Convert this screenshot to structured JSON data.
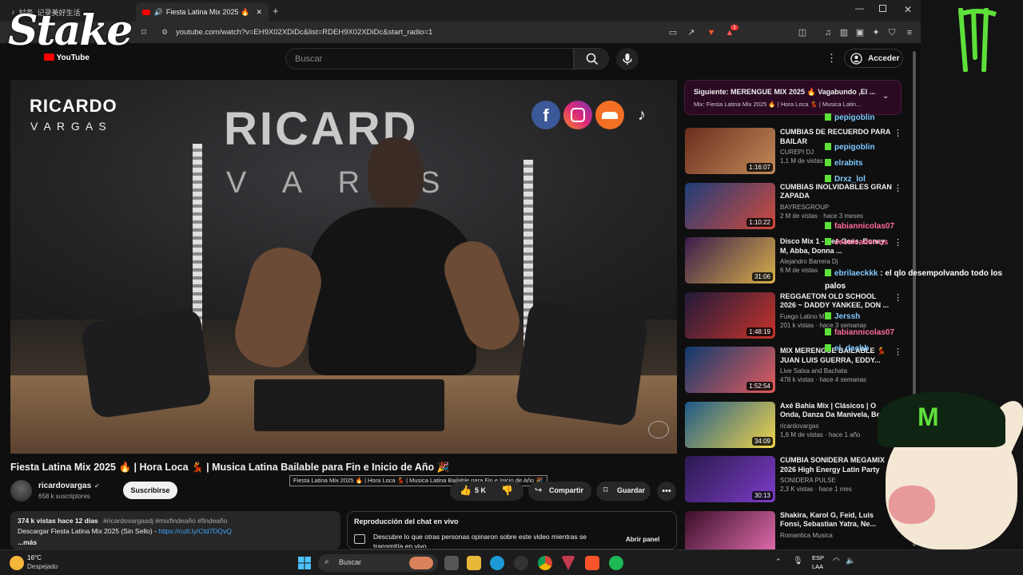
{
  "browser": {
    "tab_inactive": "村务, 记录美好生活",
    "tab_active": "Fiesta Latina Mix 2025 🔥 | Ho",
    "url": "youtube.com/watch?v=EH9X02XDiDc&list=RDEH9X02XDiDc&start_radio=1",
    "ext_badge": "1"
  },
  "overlay": {
    "stake_logo": "Stake",
    "youtube_logo": "YouTube"
  },
  "youtube": {
    "search_placeholder": "Buscar",
    "signin_label": "Acceder"
  },
  "video": {
    "branding_name": "RICARDO",
    "branding_surname": "V A R G A S",
    "wall_text_1": "RICARD",
    "wall_text_2": "V A R  S",
    "title": "Fiesta Latina Mix 2025 🔥 | Hora Loca 💃 | Musica Latina Bailable para Fin e Inicio de Año 🎉",
    "tooltip": "Fiesta Latina Mix 2025 🔥 | Hora Loca 💃 | Musica Latina Bailable para Fin e Inicio de Año 🎉",
    "channel_name": "ricardovargas",
    "subscribers": "658 k suscriptores",
    "subscribe_label": "Suscribirse",
    "likes": "5 K",
    "share_label": "Compartir",
    "save_label": "Guardar",
    "views_date": "374 k vistas  hace 12 días",
    "hashtags": "#ricardovargasdj #mixfindeaño #findeaño",
    "desc_line": "Descargar Fiesta Latina Mix 2025 (Sin Sello) - ",
    "desc_link": "https://cutt.ly/Ctd7DQvQ",
    "more_label": "...más",
    "chat_replay_title": "Reproducción del chat en vivo",
    "chat_replay_text": "Descubre lo que otras personas opinaron sobre este video mientras se transmitía en vivo.",
    "open_panel_label": "Abrir panel"
  },
  "sidebar": {
    "next_label": "Siguiente: MERENGUE MIX 2025 🔥 Vagabundo ,El ...",
    "next_sub": "Mix: Fiesta Latina Mix 2025 🔥 | Hora Loca 💃 | Musica Latin...",
    "recs": [
      {
        "title": "CUMBIAS DE RECUERDO PARA BAILAR",
        "channel": "CUREPI DJ",
        "views": "1,1 M de vistas",
        "duration": "1:16:07"
      },
      {
        "title": "CUMBIAS INOLVIDABLES GRAN ZAPADA",
        "channel": "BAYRESGROUP",
        "views": "2 M de vistas · hace 3 meses",
        "duration": "1:10:22"
      },
      {
        "title": "Disco Mix 1 - Bee Gees, Boney M, Abba, Donna ...",
        "channel": "Alejandro Barrera Dj",
        "views": "6 M de vistas",
        "duration": "31:06"
      },
      {
        "title": "REGGAETON OLD SCHOOL 2026 ~ DADDY YANKEE, DON ...",
        "channel": "Fuego Latino M",
        "views": "201 k vistas · hace 3 semanas",
        "duration": "1:48:19"
      },
      {
        "title": "MIX MERENGUE BAILABLE 💃 JUAN LUIS GUERRA, EDDY...",
        "channel": "Live Salsa and Bachata",
        "views": "478 k vistas · hace 4 semanas",
        "duration": "1:52:54"
      },
      {
        "title": "Axé Bahia Mix | Clásicos | O Onda, Danza Da Manivela, Be",
        "channel": "ricardovargas",
        "views": "1,6 M de vistas · hace 1 año",
        "duration": "34:09"
      },
      {
        "title": "CUMBIA SONIDERA MEGAMIX 2026 High Energy Latin Party",
        "channel": "SONIDERA PULSE",
        "views": "2,3 K vistas · hace 1 mes",
        "duration": "30:13"
      },
      {
        "title": "Shakira, Karol G, Feid, Luis Fonsi, Sebastian Yatra, Ne...",
        "channel": "Romantica Musica",
        "views": "",
        "duration": ""
      }
    ]
  },
  "chat_overlay": [
    {
      "user": "pepigoblin",
      "msg": "",
      "color": "#7ec8ff"
    },
    {
      "user": "pepigoblin",
      "msg": "",
      "color": "#7ec8ff"
    },
    {
      "user": "elrabits",
      "msg": "",
      "color": "#7ec8ff"
    },
    {
      "user": "Drxz_lol",
      "msg": "",
      "color": "#7ec8ff"
    },
    {
      "user": "fabiannicolas07",
      "msg": "",
      "color": "#ff6b9d"
    },
    {
      "user": "Jessicaderrus",
      "msg": "",
      "color": "#ff6b9d"
    },
    {
      "user": "ebrilaeckkk",
      "msg": ": el qlo desempolvando todo los palos",
      "color": "#7ec8ff"
    },
    {
      "user": "Jerssh",
      "msg": "",
      "color": "#7ec8ff"
    },
    {
      "user": "fabiannicolas07",
      "msg": "",
      "color": "#ff6b9d"
    },
    {
      "user": "el_dachb",
      "msg": "",
      "color": "#7ec8ff"
    }
  ],
  "taskbar": {
    "weather_temp": "16°C",
    "weather_desc": "Despejado",
    "search_label": "Buscar",
    "lang_top": "ESP",
    "lang_bottom": "LAA"
  }
}
